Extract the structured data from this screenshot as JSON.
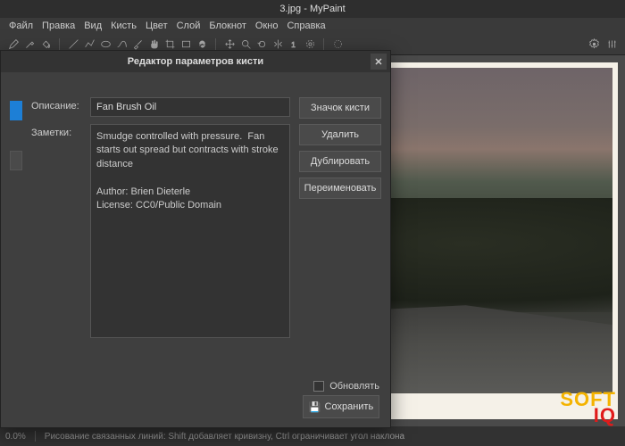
{
  "app": {
    "title": "3.jpg - MyPaint"
  },
  "menu": {
    "file": "Файл",
    "edit": "Правка",
    "view": "Вид",
    "brush": "Кисть",
    "color": "Цвет",
    "layer": "Слой",
    "notebook": "Блокнот",
    "window": "Окно",
    "help": "Справка"
  },
  "dialog": {
    "title": "Редактор параметров кисти",
    "desc_label": "Описание:",
    "notes_label": "Заметки:",
    "desc_value": "Fan Brush Oil",
    "notes_value": "Smudge controlled with pressure.  Fan starts out spread but contracts with stroke distance\n\nAuthor: Brien Dieterle\nLicense: CC0/Public Domain",
    "buttons": {
      "icon": "Значок кисти",
      "delete": "Удалить",
      "duplicate": "Дублировать",
      "rename": "Переименовать"
    },
    "update_label": "Обновлять",
    "save_label": "Сохранить"
  },
  "status": {
    "zoom": "0.0%",
    "hint": "Рисование связанных линий: Shift добавляет кривизну, Ctrl ограничивает угол наклона"
  },
  "watermark": {
    "line1": "SOFT",
    "line2": "IQ"
  }
}
